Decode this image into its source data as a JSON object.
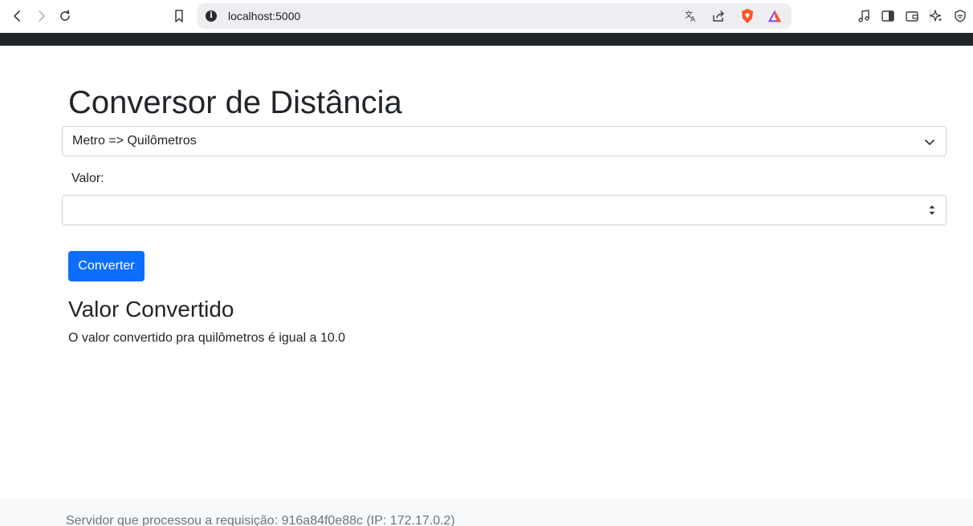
{
  "browser": {
    "url": "localhost:5000",
    "icons": [
      "back-icon",
      "forward-icon",
      "reload-icon",
      "bookmark-icon",
      "site-info-icon",
      "translate-icon",
      "share-icon",
      "brave-shields-icon",
      "brave-rewards-icon",
      "music-icon",
      "sidebar-icon",
      "wallet-icon",
      "leo-ai-icon",
      "vpn-icon"
    ]
  },
  "page": {
    "title": "Conversor de Distância",
    "select": {
      "selected": "Metro => Quilômetros"
    },
    "value_label": "Valor:",
    "value_input": "",
    "convert_button": "Converter",
    "result_title": "Valor Convertido",
    "result_text": "O valor convertido pra quilômetros é igual a 10.0"
  },
  "footer": {
    "text": "Servidor que processou a requisição: 916a84f0e88c (IP: 172.17.0.2)"
  },
  "colors": {
    "primary": "#0d6efd",
    "navbar": "#212529",
    "footer_bg": "#f8f9fa",
    "brave_orange": "#fb542b"
  }
}
